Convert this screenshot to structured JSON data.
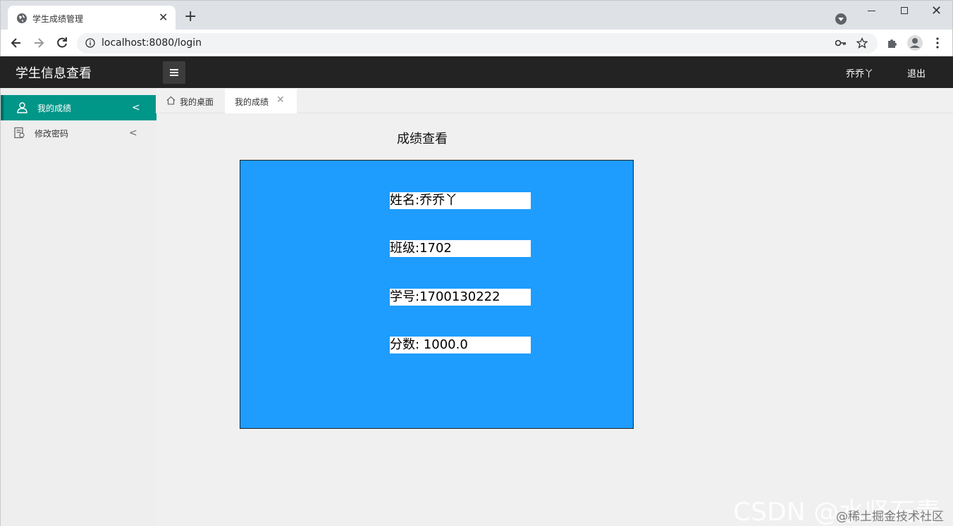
{
  "browser": {
    "tab_title": "学生成绩管理",
    "url": "localhost:8080/login"
  },
  "header": {
    "logo": "学生信息查看",
    "user": "乔乔丫",
    "logout": "退出"
  },
  "sidebar": {
    "items": [
      {
        "label": "我的成绩"
      },
      {
        "label": "修改密码"
      }
    ]
  },
  "tabs": [
    {
      "label": "我的桌面"
    },
    {
      "label": "我的成绩"
    }
  ],
  "content": {
    "title": "成绩查看",
    "fields": {
      "name": "姓名:乔乔丫",
      "class": "班级:1702",
      "student_id": "学号:1700130222",
      "score": "分数: 1000.0"
    }
  },
  "watermark": {
    "main": "CSDN @水坚石青",
    "sub": "@稀土掘金技术社区"
  },
  "colors": {
    "header_bg": "#232323",
    "sidebar_active": "#009688",
    "card_bg": "#1e9dff"
  },
  "icons": [
    "globe-icon",
    "close-icon",
    "plus-icon",
    "back-icon",
    "forward-icon",
    "reload-icon",
    "info-icon",
    "key-icon",
    "star-icon",
    "extensions-icon",
    "account-icon",
    "menu-dots-icon",
    "hamburger-icon",
    "user-icon",
    "document-icon",
    "chevron-left-icon",
    "home-icon"
  ]
}
